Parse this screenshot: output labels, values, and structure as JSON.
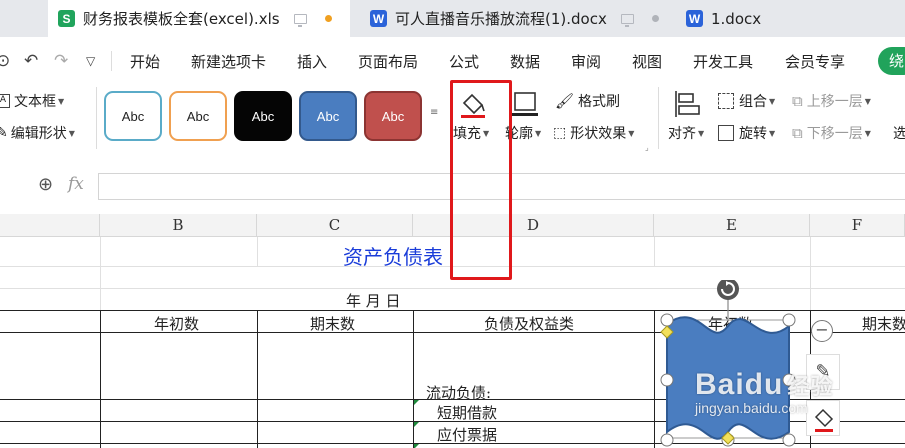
{
  "tabs": [
    {
      "label": "财务报表模板全套(excel).xls",
      "type": "S",
      "active": true
    },
    {
      "label": "可人直播音乐播放流程(1).docx",
      "type": "W",
      "active": false
    },
    {
      "label": "1.docx",
      "type": "W",
      "active": false
    }
  ],
  "menu": [
    "开始",
    "新建选项卡",
    "插入",
    "页面布局",
    "公式",
    "数据",
    "审阅",
    "视图",
    "开发工具",
    "会员专享"
  ],
  "menu_cut": "绕",
  "ribbon": {
    "textbox": "文本框",
    "edit_shape": "编辑形状",
    "style_label": "Abc",
    "fill": "填充",
    "outline": "轮廓",
    "format_painter": "格式刷",
    "shape_effects": "形状效果",
    "align": "对齐",
    "group": "组合",
    "rotate": "旋转",
    "bring_forward": "上移一层",
    "send_backward": "下移一层",
    "cut_text": "选"
  },
  "formula": {
    "fx": "fx",
    "value": ""
  },
  "columns": [
    "B",
    "C",
    "D",
    "E",
    "F"
  ],
  "sheet": {
    "title": "资产负债表",
    "date": "年    月    日",
    "headers": [
      "年初数",
      "期末数",
      "负债及权益类",
      "年初数",
      "期末数"
    ],
    "rows": [
      "流动负债:",
      "短期借款",
      "应付票据"
    ]
  },
  "watermark": {
    "brand": "Baidu",
    "site": "jingyan.baidu.com",
    "suffix": "经验"
  },
  "colors": {
    "accent_red": "#e0181b",
    "shape_blue": "#4a7dc0",
    "title_blue": "#1a3cd9"
  }
}
